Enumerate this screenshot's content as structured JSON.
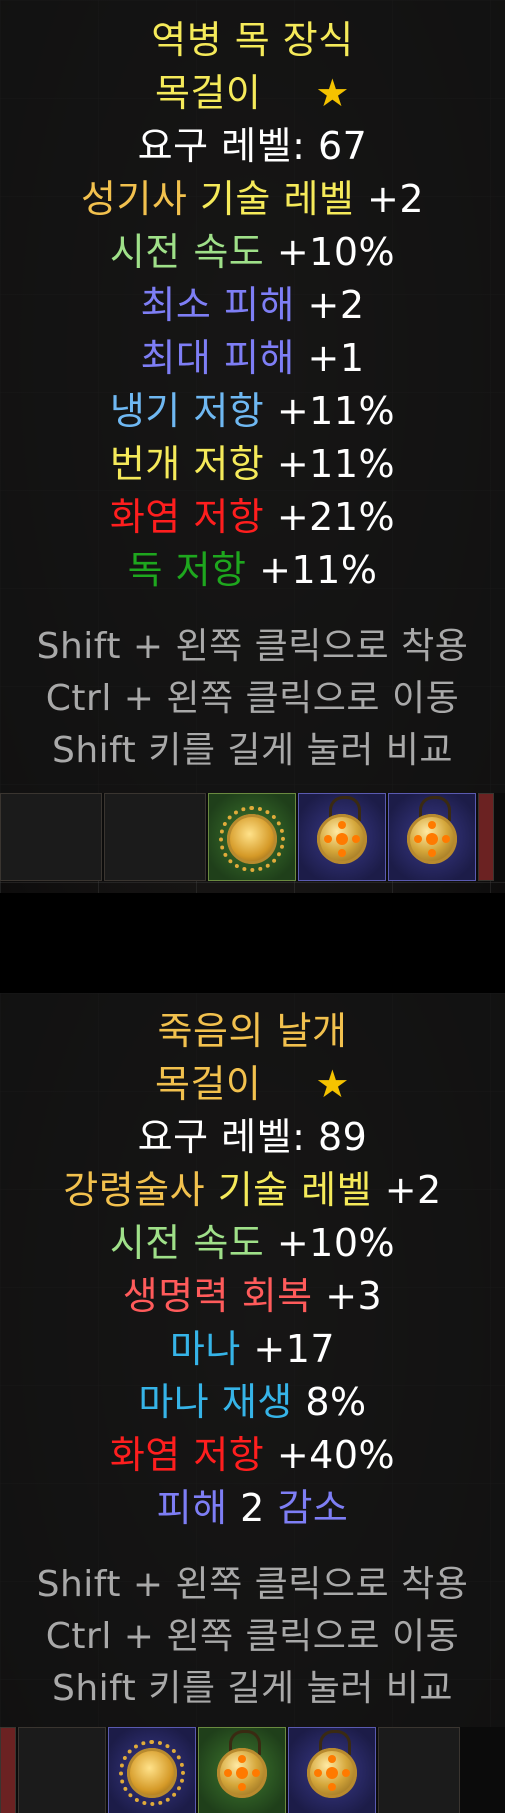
{
  "item1": {
    "name": "역병 목 장식",
    "type": "목걸이",
    "star": "★",
    "req_label": "요구 레벨: 67",
    "skill_prefix": "성기사",
    "skill_label": "기술 레벨",
    "skill_value": "+2",
    "fcr_label": "시전 속도",
    "fcr_value": "+10%",
    "min_dmg_label": "최소 피해",
    "min_dmg_value": "+2",
    "max_dmg_label": "최대 피해",
    "max_dmg_value": "+1",
    "cold_label": "냉기 저항",
    "cold_value": "+11%",
    "light_label": "번개 저항",
    "light_value": "+11%",
    "fire_label": "화염 저항",
    "fire_value": "+21%",
    "poison_label": "독 저항",
    "poison_value": "+11%"
  },
  "item2": {
    "name": "죽음의 날개",
    "type": "목걸이",
    "star": "★",
    "req_label": "요구 레벨: 89",
    "skill_prefix": "강령술사",
    "skill_label": "기술 레벨",
    "skill_value": "+2",
    "fcr_label": "시전 속도",
    "fcr_value": "+10%",
    "life_regen_label": "생명력 회복",
    "life_regen_value": "+3",
    "mana_label": "마나",
    "mana_value": "+17",
    "mana_regen_label": "마나 재생",
    "mana_regen_value": "8%",
    "fire_label": "화염 저항",
    "fire_value": "+40%",
    "dr_label1": "피해",
    "dr_value": "2",
    "dr_label2": "감소"
  },
  "hints": {
    "equip": "Shift + 왼쪽 클릭으로 착용",
    "move": "Ctrl + 왼쪽 클릭으로 이동",
    "compare": "Shift 키를 길게 눌러 비교"
  },
  "colors": {
    "unique_name": "#f2c14e",
    "set_name": "#f5ea5a",
    "magic_blue": "#7e7ef5",
    "fire_red": "#ff1e1e",
    "poison_green": "#1ea71e",
    "hint_gray": "#a9a9a9"
  },
  "icons": [
    "sun-amulet-icon",
    "cross-amulet-icon",
    "star-icon"
  ]
}
